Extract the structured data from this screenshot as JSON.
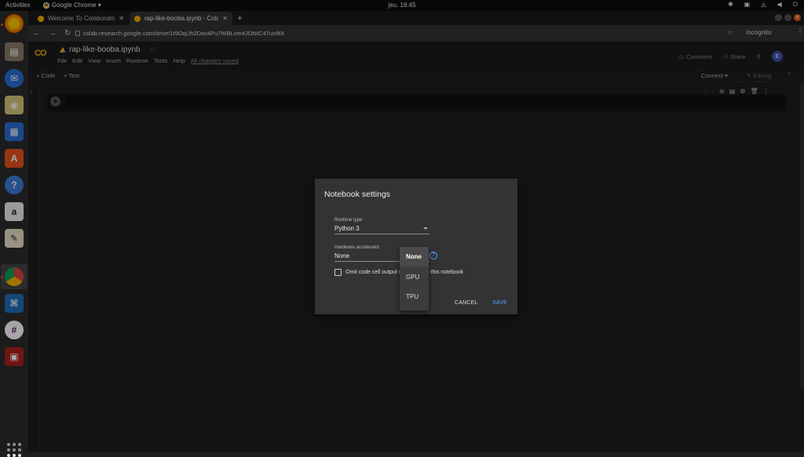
{
  "os_topbar": {
    "activities": "Activities",
    "app_name": "Google Chrome ▾",
    "clock": "jeu. 16:45"
  },
  "dock": {
    "apps": [
      "firefox-icon",
      "files-icon",
      "thunderbird-icon",
      "rhythmbox-icon",
      "writer-icon",
      "software-center-icon",
      "help-icon",
      "amazon-icon",
      "text-editor-icon",
      "chrome-icon",
      "vscode-icon",
      "slack-icon",
      "screen-recorder-icon"
    ]
  },
  "browser": {
    "tabs": [
      {
        "title": "Welcome To Colaboratory",
        "close": "✕"
      },
      {
        "title": "rap-like-booba.ipynb - Colab",
        "close": "✕"
      }
    ],
    "new_tab": "+",
    "url": "colab.research.google.com/drive/1t9OqUh2Dov4Pu7WBLvm4JONIC47uo9tX",
    "incognito": "Incognito"
  },
  "colab": {
    "logo": "CO",
    "notebook_title": "rap-like-booba.ipynb",
    "menus": [
      "File",
      "Edit",
      "View",
      "Insert",
      "Runtime",
      "Tools",
      "Help"
    ],
    "save_status": "All changes saved",
    "comment": "Comment",
    "share": "Share",
    "avatar": "E",
    "add_code": "+ Code",
    "add_text": "+ Text",
    "connect": "Connect ▾",
    "editing": "✎ Editing"
  },
  "dialog": {
    "title": "Notebook settings",
    "runtime_label": "Runtime type",
    "runtime_value": "Python 3",
    "accel_label": "Hardware accelerator",
    "accel_value": "None",
    "omit_label": "Omit code cell output when saving this notebook",
    "cancel": "CANCEL",
    "save": "SAVE",
    "accel_options": [
      "None",
      "GPU",
      "TPU"
    ]
  },
  "colors": {
    "accent": "#4fa3ff",
    "colab_orange": "#f9ab00",
    "ubuntu_orange": "#e95420"
  }
}
